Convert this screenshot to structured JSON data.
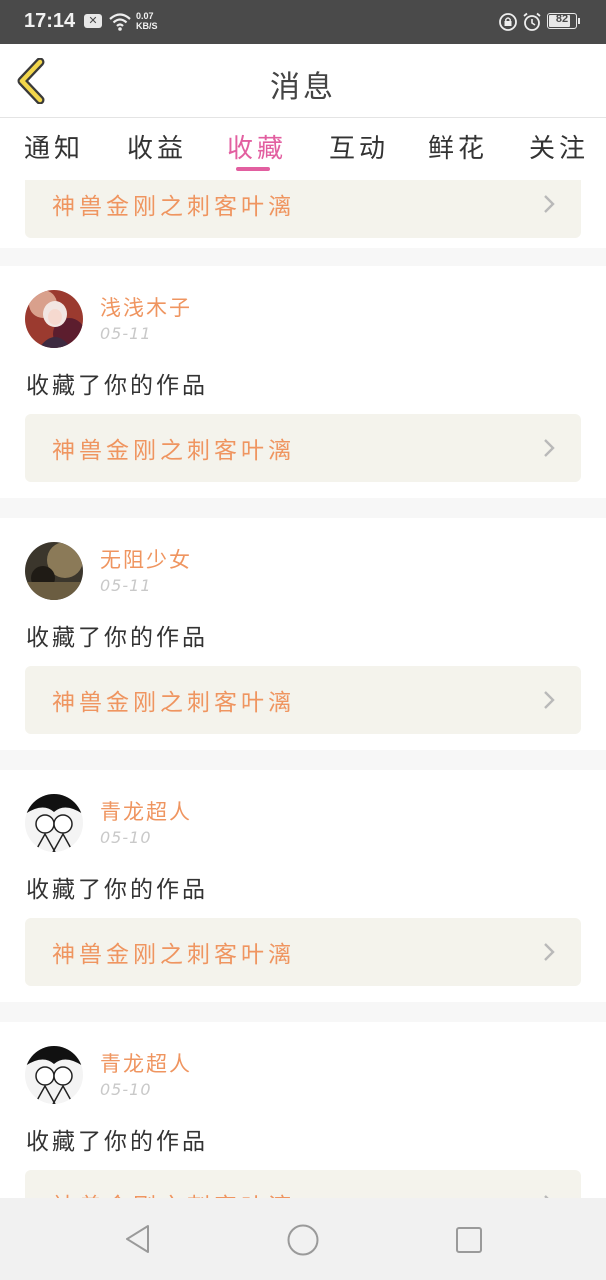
{
  "status_bar": {
    "time": "17:14",
    "speed_value": "0.07",
    "speed_unit": "KB/S",
    "battery": "82",
    "battery_level": 0.82,
    "icons": [
      "notification-x-icon",
      "wifi-icon",
      "rotation-lock-icon",
      "alarm-icon",
      "battery-icon"
    ]
  },
  "header": {
    "title": "消息",
    "back_icon": "chevron-left-icon"
  },
  "tabs": [
    {
      "label": "通知",
      "active": false
    },
    {
      "label": "收益",
      "active": false
    },
    {
      "label": "收藏",
      "active": true
    },
    {
      "label": "互动",
      "active": false
    },
    {
      "label": "鲜花",
      "active": false
    },
    {
      "label": "关注",
      "active": false
    }
  ],
  "colors": {
    "accent_pink": "#e25fa0",
    "accent_orange": "#ef9560",
    "work_box_bg": "#f4f3ec"
  },
  "partial_top_item": {
    "work_title": "神兽金刚之刺客叶漓"
  },
  "items": [
    {
      "username": "浅浅木子",
      "date": "05-11",
      "action": "收藏了你的作品",
      "work_title": "神兽金刚之刺客叶漓"
    },
    {
      "username": "无阻少女",
      "date": "05-11",
      "action": "收藏了你的作品",
      "work_title": "神兽金刚之刺客叶漓"
    },
    {
      "username": "青龙超人",
      "date": "05-10",
      "action": "收藏了你的作品",
      "work_title": "神兽金刚之刺客叶漓"
    },
    {
      "username": "青龙超人",
      "date": "05-10",
      "action": "收藏了你的作品",
      "work_title": "神兽金刚之刺客叶漓"
    }
  ],
  "nav_bar": {
    "buttons": [
      "back-triangle-icon",
      "home-circle-icon",
      "recents-square-icon"
    ]
  }
}
